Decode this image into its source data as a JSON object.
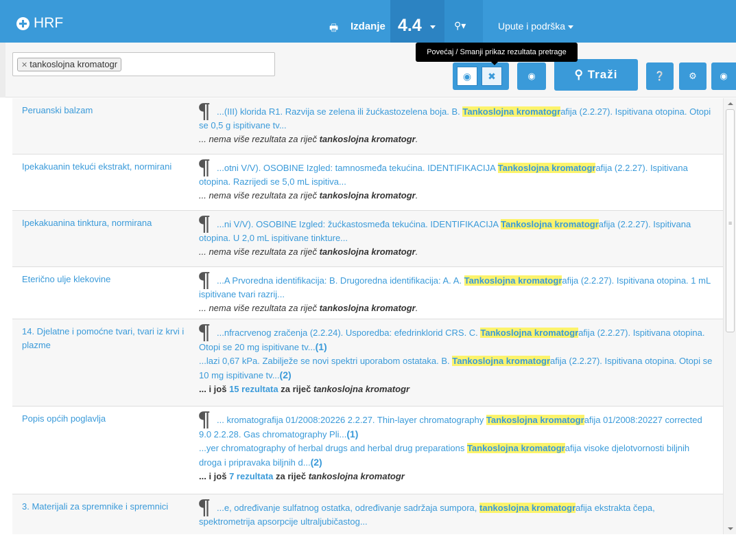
{
  "header": {
    "brand": "HRF",
    "print_icon": "print-icon",
    "fullscreen_icon": "expand-icon",
    "edition_label": "Izdanje",
    "edition_value": "4.4",
    "search_icon": "search-icon",
    "support_label": "Upute i podrška",
    "color": "#3a9ad9"
  },
  "search": {
    "tag": "tankoslojna kromatogr",
    "tooltip": "Povećaj / Smanji prikaz rezultata pretrage",
    "search_button": "Traži",
    "icons": [
      "eye-icon",
      "expand-icon",
      "eye-icon",
      "search-icon",
      "help-icon",
      "gear-icon",
      "circle-icon"
    ]
  },
  "results": [
    {
      "title": "Peruanski balzam",
      "snippets": [
        {
          "pre": "...(III) klorida R1. Razvija se zelena ili žućkastozelena boja. B. ",
          "hl": "Tankoslojna kromatogr",
          "post": "afija (2.2.27). Ispitivana otopina. Otopi se 0,5 g ispitivane tv...",
          "ref": ""
        }
      ],
      "footer_prefix": "... nema više rezultata za riječ ",
      "footer_term": "tankoslojna kromatogr",
      "footer_suffix": ".",
      "more": false
    },
    {
      "title": "Ipekakuanin tekući ekstrakt, normirani",
      "snippets": [
        {
          "pre": "...otni V/V). OSOBINE Izgled: tamnosmeđa tekućina. IDENTIFIKACIJA ",
          "hl": "Tankoslojna kromatogr",
          "post": "afija (2.2.27). Ispitivana otopina. Razrijedi se 5,0 mL ispitiva...",
          "ref": ""
        }
      ],
      "footer_prefix": "... nema više rezultata za riječ ",
      "footer_term": "tankoslojna kromatogr",
      "footer_suffix": ".",
      "more": false
    },
    {
      "title": "Ipekakuanina tinktura, normirana",
      "snippets": [
        {
          "pre": "...ni V/V). OSOBINE Izgled: žućkastosmeđa tekućina. IDENTIFIKACIJA ",
          "hl": "Tankoslojna kromatogr",
          "post": "afija (2.2.27). Ispitivana otopina. U 2,0 mL ispitivane tinkture...",
          "ref": ""
        }
      ],
      "footer_prefix": "... nema više rezultata za riječ ",
      "footer_term": "tankoslojna kromatogr",
      "footer_suffix": ".",
      "more": false
    },
    {
      "title": "Eterično ulje klekovine",
      "snippets": [
        {
          "pre": "...A Prvoredna identifikacija: B. Drugoredna identifikacija: A. A. ",
          "hl": "Tankoslojna kromatogr",
          "post": "afija (2.2.27). Ispitivana otopina. 1 mL ispitivane tvari razrij...",
          "ref": ""
        }
      ],
      "footer_prefix": "... nema više rezultata za riječ ",
      "footer_term": "tankoslojna kromatogr",
      "footer_suffix": ".",
      "more": false
    },
    {
      "title": "14. Djelatne i pomoćne tvari, tvari iz krvi i plazme",
      "snippets": [
        {
          "pre": "...nfracrvenog zračenja (2.2.24). Usporedba: efedrinklorid CRS. C. ",
          "hl": "Tankoslojna kromatogr",
          "post": "afija (2.2.27). Ispitivana otopina. Otopi se 20 mg ispitivane tv...",
          "ref": "(1)"
        },
        {
          "pre": "...lazi 0,67 kPa. Zabilježe se novi spektri uporabom ostataka. B. ",
          "hl": "Tankoslojna kromatogr",
          "post": "afija (2.2.27). Ispitivana otopina. Otopi se 10 mg ispitivane tv...",
          "ref": "(2)"
        }
      ],
      "footer_prefix": "... i još ",
      "footer_count": "15 rezultata",
      "footer_mid": " za riječ ",
      "footer_term": "tankoslojna kromatogr",
      "more": true
    },
    {
      "title": "Popis općih poglavlja",
      "snippets": [
        {
          "pre": "... kromatografija 01/2008:20226 2.2.27. Thin-layer chromatography ",
          "hl": "Tankoslojna kromatogr",
          "post": "afija 01/2008:20227 corrected 9.0 2.2.28. Gas chromatography Pli...",
          "ref": "(1)"
        },
        {
          "pre": "...yer chromatography of herbal drugs and herbal drug preparations ",
          "hl": "Tankoslojna kromatogr",
          "post": "afija visoke djelotvornosti biljnih droga i pripravaka biljnih d...",
          "ref": "(2)"
        }
      ],
      "footer_prefix": "... i još ",
      "footer_count": "7 rezultata",
      "footer_mid": " za riječ ",
      "footer_term": "tankoslojna kromatogr",
      "more": true
    },
    {
      "title": "3. Materijali za spremnike i spremnici",
      "snippets": [
        {
          "pre": "...e, određivanje sulfatnog ostatka, određivanje sadržaja sumpora, ",
          "hl": "tankoslojna kromatogr",
          "post": "afija ekstrakta čepa, spektrometrija apsorpcije ultraljubičastog...",
          "ref": ""
        }
      ],
      "footer_prefix": "",
      "footer_term": "",
      "more": false,
      "truncated": true
    }
  ]
}
